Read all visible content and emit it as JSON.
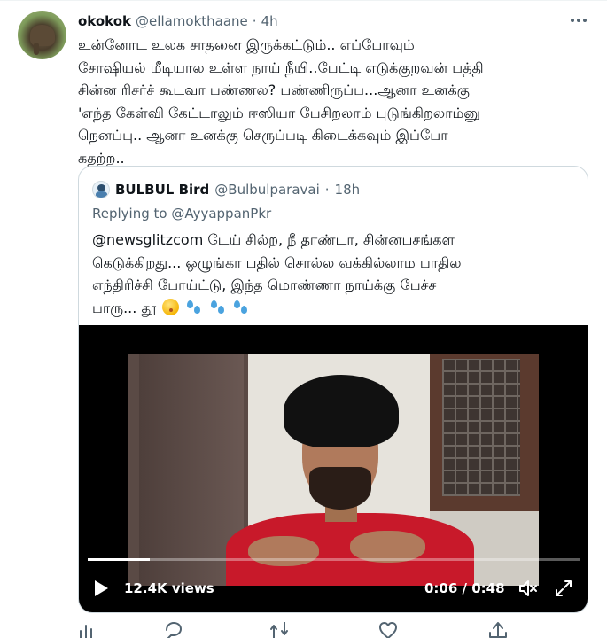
{
  "tweet": {
    "display_name": "okokok",
    "handle": "@ellamokthaane",
    "separator": "·",
    "timestamp": "4h",
    "text_lines": [
      "உன்னோட உலக சாதனை இருக்கட்டும்.. எப்போவும்",
      "சோஷியல் மீடியால உள்ள நாய் நீயி..பேட்டி எடுக்குறவன் பத்தி",
      "சின்ன ரிசர்ச் கூடவா பண்ணல? பண்ணிருப்ப...ஆனா உனக்கு",
      "'எந்த கேள்வி கேட்டாலும் ஈஸியா பேசிறலாம் புடுங்கிறலாம்னு",
      "நெனப்பு.. ஆனா உனக்கு செருப்படி கிடைக்கவும் இப்போ",
      "கதற்ற.."
    ]
  },
  "quote": {
    "display_name": "BULBUL Bird",
    "handle": "@Bulbulparavai",
    "separator": "·",
    "timestamp": "18h",
    "replying_prefix": "Replying to ",
    "replying_to": "@AyyappanPkr",
    "text_lines": [
      "@newsglitzcom டேய் சில்ற, நீ தாண்டா, சின்னபசங்கள",
      "கெடுக்கிறது... ஒழுங்கா பதில் சொல்ல வக்கில்லாம பாதில",
      "எந்திரிச்சி போய்ட்டு, இந்த மொண்ணா நாய்க்கு பேச்ச"
    ],
    "last_line_text": "பாரு... தூ",
    "emojis": [
      "kissing-face-emoji",
      "sweat-droplets-emoji",
      "sweat-droplets-emoji",
      "sweat-droplets-emoji"
    ]
  },
  "video": {
    "views": "12.4K views",
    "time": "0:06 / 0:48",
    "progress": 0.125
  },
  "colors": {
    "text": "#0f1419",
    "secondary": "#536471",
    "border": "#cfd9de",
    "shirt": "#c8192a"
  }
}
